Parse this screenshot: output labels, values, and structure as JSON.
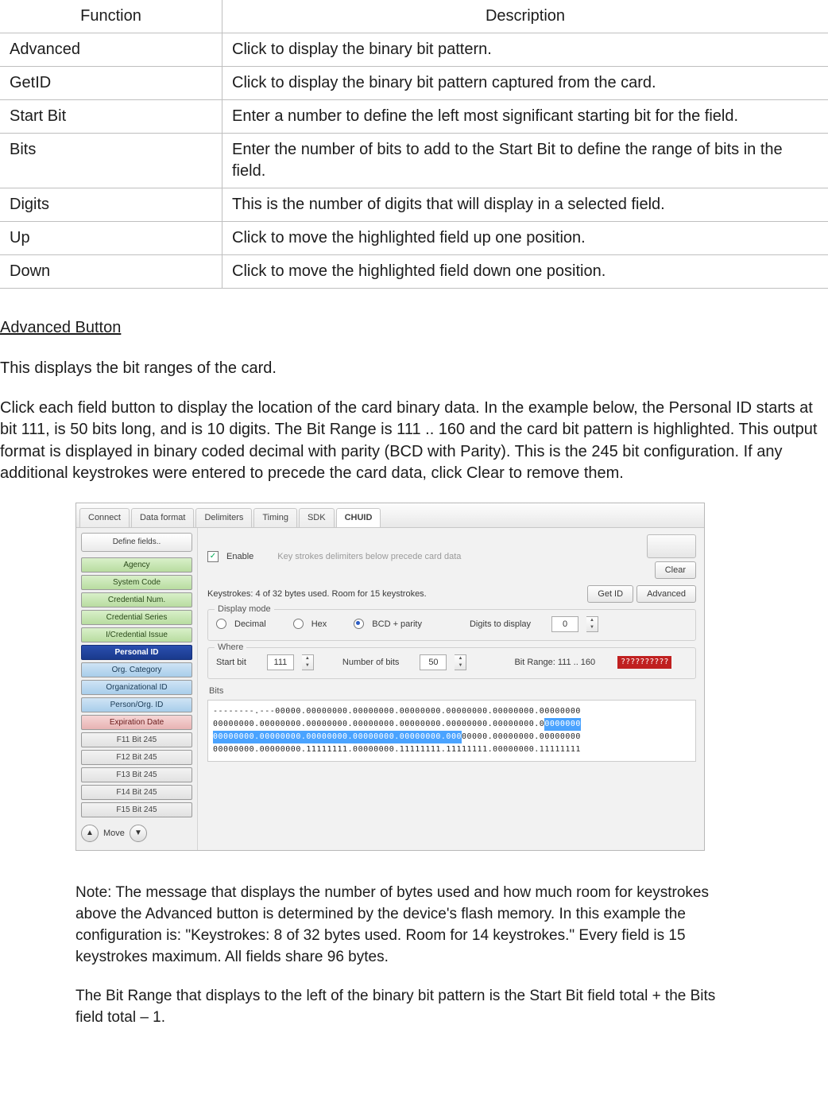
{
  "table": {
    "headers": {
      "function": "Function",
      "description": "Description"
    },
    "rows": [
      {
        "function": "Advanced",
        "description": "Click to display the binary bit pattern."
      },
      {
        "function": "GetID",
        "description": "Click to display the binary bit pattern captured from the card."
      },
      {
        "function": "Start Bit",
        "description": "Enter a number to define the left most significant starting bit for the field."
      },
      {
        "function": "Bits",
        "description": "Enter the number of bits to add to the Start Bit to define the range of bits in the field."
      },
      {
        "function": "Digits",
        "description": "This is the number of digits that will display in a selected field."
      },
      {
        "function": "Up",
        "description": "Click to move the highlighted field up one position."
      },
      {
        "function": "Down",
        "description": "Click to move the highlighted field down one position."
      }
    ]
  },
  "heading_adv": "Advanced Button",
  "para_intro": "This displays the bit ranges of the card.",
  "para_detail": "Click each field button to display the location of the card binary data. In the example below, the Personal ID starts at bit 111, is 50 bits long, and is 10 digits. The Bit Range is 111 .. 160 and the card bit pattern is highlighted. This output format is displayed in binary coded decimal with parity (BCD with Parity). This is the 245 bit configuration. If any additional keystrokes were entered to precede the card data, click Clear to remove them.",
  "note1": "Note: The message that displays the number of bytes used and how much room for keystrokes above the Advanced button is determined by the device's flash memory. In this example the configuration is: \"Keystrokes: 8 of 32 bytes used. Room for 14 keystrokes.\" Every field is 15 keystrokes maximum. All fields share 96 bytes.",
  "note2": "The Bit Range that displays to the left of the binary bit pattern is the Start Bit field total + the Bits field total – 1.",
  "app": {
    "tabs": [
      "Connect",
      "Data format",
      "Delimiters",
      "Timing",
      "SDK",
      "CHUID"
    ],
    "active_tab": "CHUID",
    "define_label": "Define fields..",
    "enable_label": "Enable",
    "enable_checked": true,
    "hint_text": "Key strokes delimiters below precede card data",
    "clear_label": "Clear",
    "keystroke_msg": "Keystrokes: 4 of 32 bytes used. Room for 15 keystrokes.",
    "getid_label": "Get ID",
    "advanced_label": "Advanced",
    "display_mode": {
      "legend": "Display mode",
      "options": [
        "Decimal",
        "Hex",
        "BCD + parity"
      ],
      "selected": "BCD + parity",
      "digits_label": "Digits to display",
      "digits_value": "0"
    },
    "where": {
      "legend": "Where",
      "start_label": "Start bit",
      "start_value": "111",
      "numbits_label": "Number of bits",
      "numbits_value": "50",
      "range_label": "Bit Range: 111 .. 160",
      "red": "??????????"
    },
    "bits_label": "Bits",
    "bits_lines": {
      "l1a": "--------.---00000.00000000.00000000.00000000.00000000.00000000.00000000",
      "l2a": "00000000.00000000.00000000.00000000.00000000.00000000.00000000.0",
      "l2b": "0000000",
      "l3a": "00000000.00000000.00000000.00000000.00000000.000",
      "l3b": "00000.00000000.00000000",
      "l4a": "00000000.00000000.11111111.00000000.11111111.11111111.00000000.11111111"
    },
    "field_buttons": [
      {
        "label": "Agency",
        "class": "green"
      },
      {
        "label": "System Code",
        "class": "green"
      },
      {
        "label": "Credential Num.",
        "class": "green"
      },
      {
        "label": "Credential Series",
        "class": "green"
      },
      {
        "label": "I/Credential Issue",
        "class": "green"
      },
      {
        "label": "Personal ID",
        "class": "sel"
      },
      {
        "label": "Org. Category",
        "class": "blue"
      },
      {
        "label": "Organizational ID",
        "class": "blue"
      },
      {
        "label": "Person/Org. ID",
        "class": "blue"
      },
      {
        "label": "Expiration Date",
        "class": "red"
      },
      {
        "label": "F11 Bit 245",
        "class": "grey"
      },
      {
        "label": "F12 Bit 245",
        "class": "grey"
      },
      {
        "label": "F13 Bit 245",
        "class": "grey"
      },
      {
        "label": "F14 Bit 245",
        "class": "grey"
      },
      {
        "label": "F15 Bit 245",
        "class": "grey"
      }
    ],
    "move_label": "Move"
  }
}
